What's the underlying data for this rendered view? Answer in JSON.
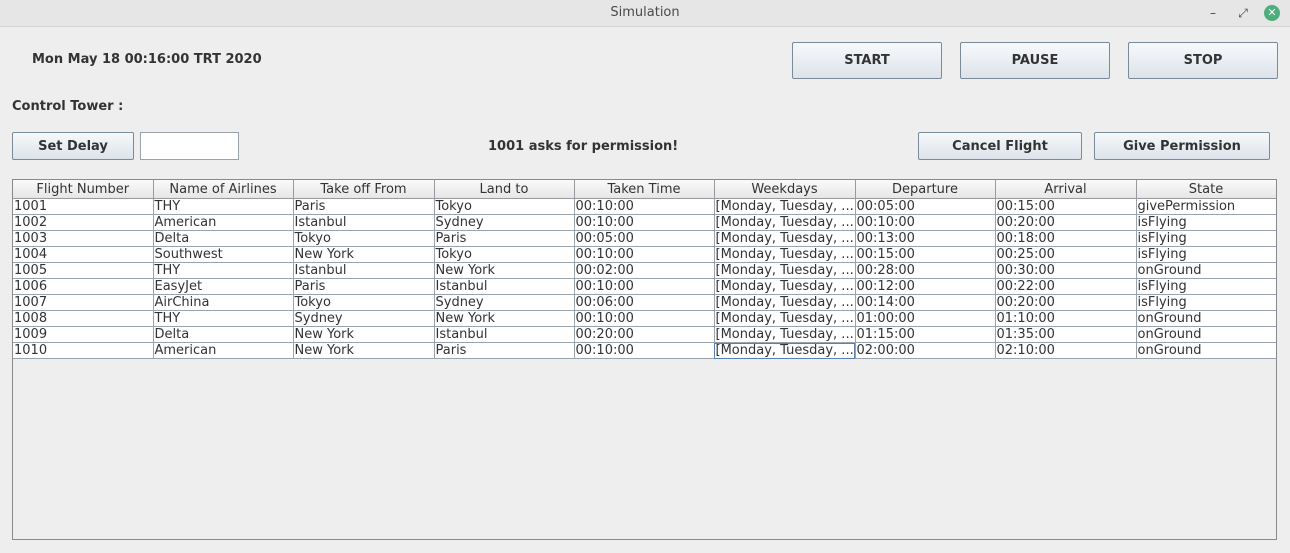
{
  "window": {
    "title": "Simulation",
    "minimize_glyph": "–",
    "maximize_glyph": "⤢",
    "close_glyph": "✕"
  },
  "clock_text": "Mon May 18 00:16:00 TRT 2020",
  "controls": {
    "start_label": "START",
    "pause_label": "PAUSE",
    "stop_label": "STOP",
    "set_delay_label": "Set Delay",
    "delay_value": "",
    "cancel_flight_label": "Cancel Flight",
    "give_permission_label": "Give Permission"
  },
  "control_tower_label": "Control Tower :",
  "permission_message": "1001 asks for permission!",
  "table": {
    "columns": [
      "Flight Number",
      "Name of Airlines",
      "Take off From",
      "Land to",
      "Taken Time",
      "Weekdays",
      "Departure",
      "Arrival",
      "State"
    ],
    "rows": [
      [
        "1001",
        "THY",
        "Paris",
        "Tokyo",
        "00:10:00",
        "[Monday, Tuesday, ...",
        "00:05:00",
        "00:15:00",
        "givePermission"
      ],
      [
        "1002",
        "American",
        "Istanbul",
        "Sydney",
        "00:10:00",
        "[Monday, Tuesday, ...",
        "00:10:00",
        "00:20:00",
        "isFlying"
      ],
      [
        "1003",
        "Delta",
        "Tokyo",
        "Paris",
        "00:05:00",
        "[Monday, Tuesday, ...",
        "00:13:00",
        "00:18:00",
        "isFlying"
      ],
      [
        "1004",
        "Southwest",
        "New York",
        "Tokyo",
        "00:10:00",
        "[Monday, Tuesday, ...",
        "00:15:00",
        "00:25:00",
        "isFlying"
      ],
      [
        "1005",
        "THY",
        "Istanbul",
        "New York",
        "00:02:00",
        "[Monday, Tuesday, ...",
        "00:28:00",
        "00:30:00",
        "onGround"
      ],
      [
        "1006",
        "EasyJet",
        "Paris",
        "Istanbul",
        "00:10:00",
        "[Monday, Tuesday, ...",
        "00:12:00",
        "00:22:00",
        "isFlying"
      ],
      [
        "1007",
        "AirChina",
        "Tokyo",
        "Sydney",
        "00:06:00",
        "[Monday, Tuesday, ...",
        "00:14:00",
        "00:20:00",
        "isFlying"
      ],
      [
        "1008",
        "THY",
        "Sydney",
        "New York",
        "00:10:00",
        "[Monday, Tuesday, ...",
        "01:00:00",
        "01:10:00",
        "onGround"
      ],
      [
        "1009",
        "Delta",
        "New York",
        "Istanbul",
        "00:20:00",
        "[Monday, Tuesday, ...",
        "01:15:00",
        "01:35:00",
        "onGround"
      ],
      [
        "1010",
        "American",
        "New York",
        "Paris",
        "00:10:00",
        "[Monday, Tuesday, ...",
        "02:00:00",
        "02:10:00",
        "onGround"
      ]
    ]
  }
}
